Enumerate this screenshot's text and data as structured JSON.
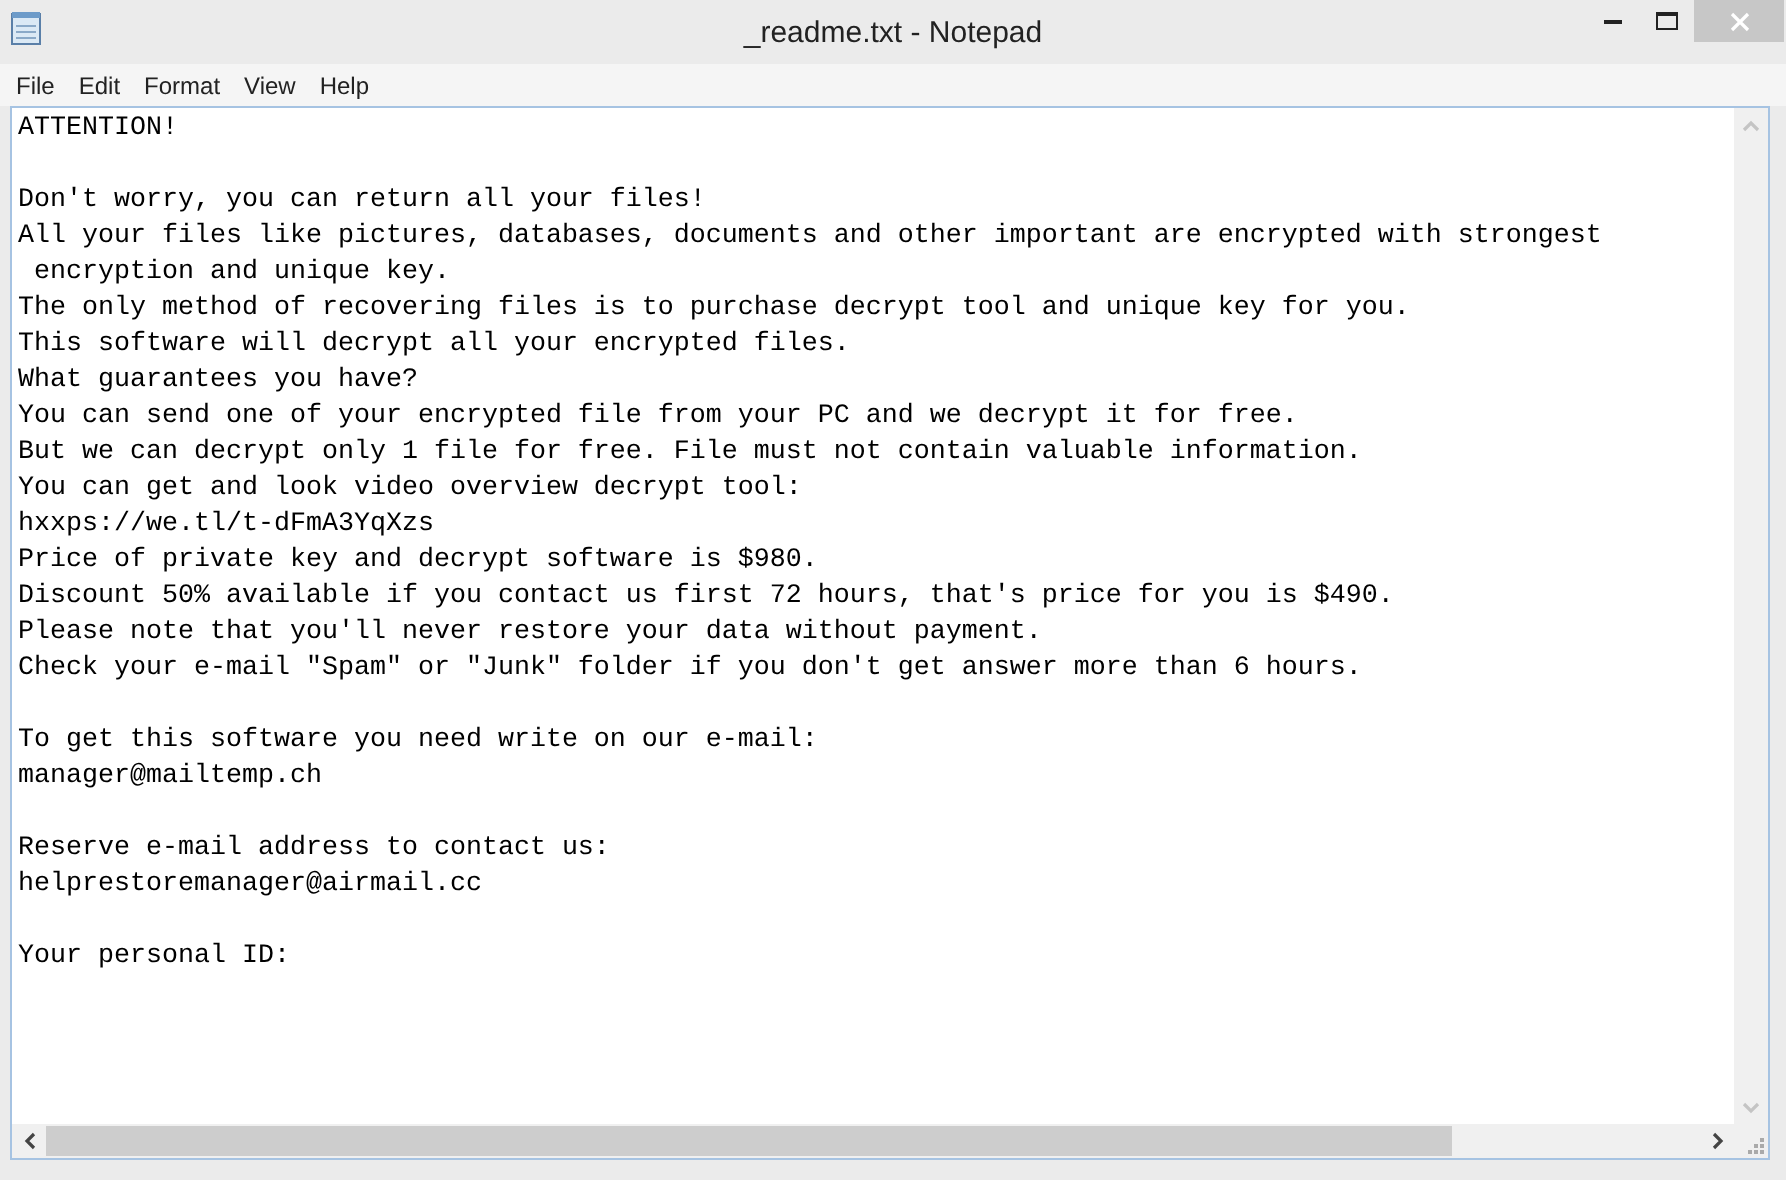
{
  "window": {
    "title": "_readme.txt - Notepad"
  },
  "menu": [
    "File",
    "Edit",
    "Format",
    "View",
    "Help"
  ],
  "document": {
    "paragraphs": [
      [
        "ATTENTION!"
      ],
      [
        "Don't worry, you can return all your files!",
        "All your files like pictures, databases, documents and other important are encrypted with strongest",
        " encryption and unique key.",
        "The only method of recovering files is to purchase decrypt tool and unique key for you.",
        "This software will decrypt all your encrypted files.",
        "What guarantees you have?",
        "You can send one of your encrypted file from your PC and we decrypt it for free.",
        "But we can decrypt only 1 file for free. File must not contain valuable information.",
        "You can get and look video overview decrypt tool:",
        "hxxps://we.tl/t-dFmA3YqXzs",
        "Price of private key and decrypt software is $980.",
        "Discount 50% available if you contact us first 72 hours, that's price for you is $490.",
        "Please note that you'll never restore your data without payment.",
        "Check your e-mail \"Spam\" or \"Junk\" folder if you don't get answer more than 6 hours."
      ],
      [
        "To get this software you need write on our e-mail:",
        "manager@mailtemp.ch"
      ],
      [
        "Reserve e-mail address to contact us:",
        "helprestoremanager@airmail.cc"
      ],
      [
        "Your personal ID:"
      ]
    ]
  }
}
